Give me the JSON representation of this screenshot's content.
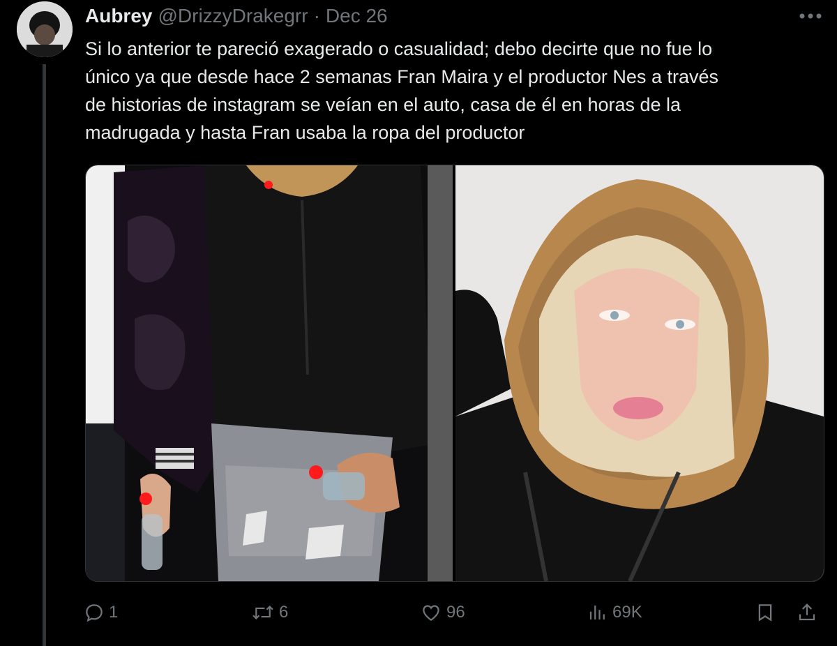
{
  "tweet": {
    "author_name": "Aubrey",
    "handle": "@DrizzyDrakegrr",
    "separator": "·",
    "date": "Dec 26",
    "text": "Si lo anterior te pareció exagerado o casualidad; debo decirte que no fue lo\núnico ya que desde hace 2 semanas Fran Maira y el productor Nes a través\nde historias de instagram se veían en el auto, casa de él en horas de la\nmadrugada y hasta Fran usaba la ropa del productor"
  },
  "actions": {
    "replies": "1",
    "reposts": "6",
    "likes": "96",
    "views": "69K"
  },
  "icons": {
    "more": "more-horizontal-icon",
    "reply": "reply-icon",
    "repost": "repost-icon",
    "like": "heart-icon",
    "views": "views-icon",
    "bookmark": "bookmark-icon",
    "share": "share-icon"
  },
  "colors": {
    "background": "#000000",
    "text_primary": "#e7e9ea",
    "text_secondary": "#71767b",
    "border": "#2f3336"
  }
}
